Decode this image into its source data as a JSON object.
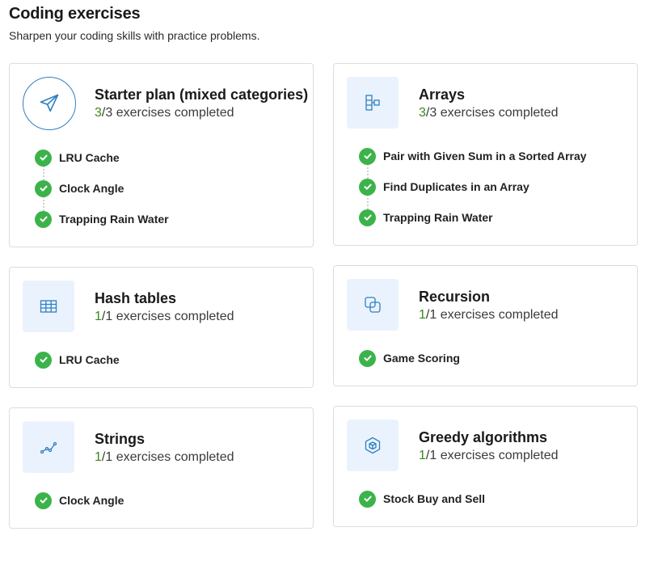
{
  "header": {
    "title": "Coding exercises",
    "subtitle": "Sharpen your coding skills with practice problems."
  },
  "colors": {
    "accent": "#2f7fc1",
    "icon_bg": "#eaf3fd",
    "check": "#3cb34a",
    "progress_done": "#3a8a1a"
  },
  "cards": [
    {
      "title": "Starter plan (mixed categories)",
      "icon": "paper-plane-icon",
      "done": "3",
      "total_text": "/3 exercises completed",
      "exercises": [
        "LRU Cache",
        "Clock Angle",
        "Trapping Rain Water"
      ]
    },
    {
      "title": "Arrays",
      "icon": "array-bracket-icon",
      "done": "3",
      "total_text": "/3 exercises completed",
      "exercises": [
        "Pair with Given Sum in a Sorted Array",
        "Find Duplicates in an Array",
        "Trapping Rain Water"
      ]
    },
    {
      "title": "Hash tables",
      "icon": "table-icon",
      "done": "1",
      "total_text": "/1 exercises completed",
      "exercises": [
        "LRU Cache"
      ]
    },
    {
      "title": "Recursion",
      "icon": "overlapping-squares-icon",
      "done": "1",
      "total_text": "/1 exercises completed",
      "exercises": [
        "Game Scoring"
      ]
    },
    {
      "title": "Strings",
      "icon": "string-chain-icon",
      "done": "1",
      "total_text": "/1 exercises completed",
      "exercises": [
        "Clock Angle"
      ]
    },
    {
      "title": "Greedy algorithms",
      "icon": "cube-icon",
      "done": "1",
      "total_text": "/1 exercises completed",
      "exercises": [
        "Stock Buy and Sell"
      ]
    }
  ]
}
